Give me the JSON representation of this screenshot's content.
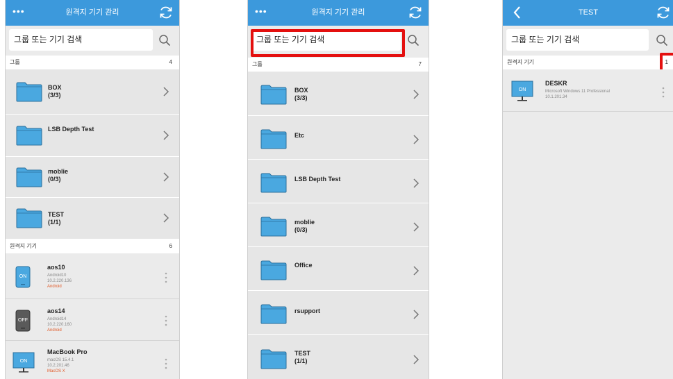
{
  "colors": {
    "accent": "#3c99dc",
    "folder": "#4aa8e0",
    "highlight": "#e4100f",
    "platform_text": "#e05a28"
  },
  "panel1": {
    "title": "원격지 기기 관리",
    "search_placeholder": "그룹 또는 기기 검색",
    "groups_label": "그룹",
    "groups_count": "4",
    "groups": [
      {
        "name": "BOX",
        "count": "(3/3)"
      },
      {
        "name": "LSB Depth Test",
        "count": ""
      },
      {
        "name": "moblie",
        "count": "(0/3)"
      },
      {
        "name": "TEST",
        "count": "(1/1)"
      }
    ],
    "devices_label": "원격지 기기",
    "devices_count": "6",
    "devices": [
      {
        "name": "aos10",
        "os": "Android10",
        "ip": "10.2.220.136",
        "platform": "Android",
        "icon": "phone-on-icon",
        "status": "ON"
      },
      {
        "name": "aos14",
        "os": "Android14",
        "ip": "10.2.220.160",
        "platform": "Android",
        "icon": "phone-off-icon",
        "status": "OFF"
      },
      {
        "name": "MacBook Pro",
        "os": "macOS 15.4.1",
        "ip": "10.2.201.46",
        "platform": "MacOS X",
        "icon": "monitor-on-icon",
        "status": "ON"
      }
    ]
  },
  "panel2": {
    "title": "원격지 기기 관리",
    "search_placeholder": "그룹 또는 기기 검색",
    "groups_label": "그룹",
    "groups_count": "7",
    "groups": [
      {
        "name": "BOX",
        "count": "(3/3)"
      },
      {
        "name": "Etc",
        "count": ""
      },
      {
        "name": "LSB Depth Test",
        "count": ""
      },
      {
        "name": "moblie",
        "count": "(0/3)"
      },
      {
        "name": "Office",
        "count": ""
      },
      {
        "name": "rsupport",
        "count": ""
      },
      {
        "name": "TEST",
        "count": "(1/1)"
      }
    ]
  },
  "panel3": {
    "title": "TEST",
    "search_placeholder": "그룹 또는 기기 검색",
    "devices_label": "원격지 기기",
    "devices_count": "1",
    "devices": [
      {
        "name": "DESKR",
        "os": "Microsoft Windows 11 Professional",
        "ip": "10.1.201.34",
        "icon": "monitor-on-icon",
        "status": "ON"
      }
    ]
  }
}
